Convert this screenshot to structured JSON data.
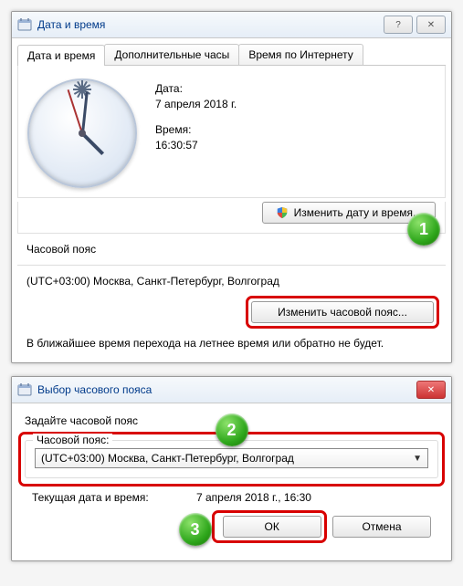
{
  "badges": {
    "one": "1",
    "two": "2",
    "three": "3"
  },
  "win1": {
    "title": "Дата и время",
    "tabs": {
      "t1": "Дата и время",
      "t2": "Дополнительные часы",
      "t3": "Время по Интернету"
    },
    "date_label": "Дата:",
    "date_value": "7 апреля 2018 г.",
    "time_label": "Время:",
    "time_value": "16:30:57",
    "change_dt_btn": "Изменить дату и время...",
    "tz_section_label": "Часовой пояс",
    "tz_value": "(UTC+03:00) Москва, Санкт-Петербург, Волгоград",
    "change_tz_btn": "Изменить часовой пояс...",
    "dst_note": "В ближайшее время перехода на летнее время или обратно не будет."
  },
  "win2": {
    "title": "Выбор часового пояса",
    "prompt": "Задайте часовой пояс",
    "group_label": "Часовой пояс:",
    "combo_value": "(UTC+03:00) Москва, Санкт-Петербург, Волгоград",
    "current_dt_label": "Текущая дата и время:",
    "current_dt_value": "7 апреля 2018 г., 16:30",
    "ok": "ОК",
    "cancel": "Отмена"
  }
}
